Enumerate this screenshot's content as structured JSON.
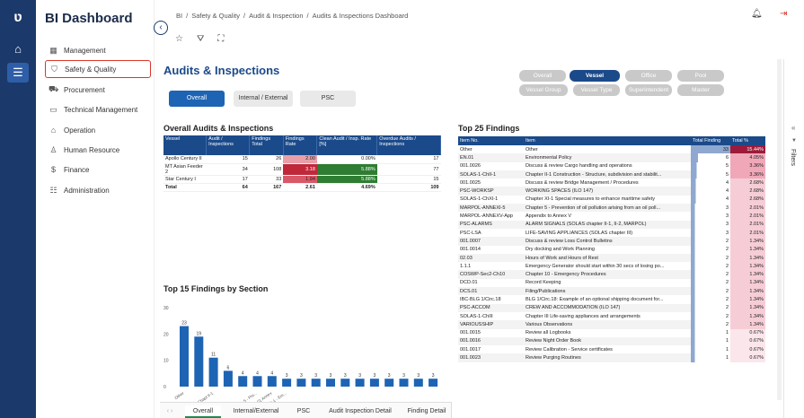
{
  "app": {
    "title": "BI Dashboard"
  },
  "rail": {
    "logo": "ʋ",
    "icons": [
      "home-icon",
      "list-icon"
    ]
  },
  "sidebar": {
    "items": [
      {
        "label": "Management",
        "icon": "grid-icon",
        "glyph": "▦"
      },
      {
        "label": "Safety & Quality",
        "icon": "shield-icon",
        "glyph": "⛉",
        "active": true
      },
      {
        "label": "Procurement",
        "icon": "cart-icon",
        "glyph": "⛟"
      },
      {
        "label": "Technical Management",
        "icon": "monitor-icon",
        "glyph": "▭"
      },
      {
        "label": "Operation",
        "icon": "building-icon",
        "glyph": "⌂"
      },
      {
        "label": "Human Resource",
        "icon": "person-icon",
        "glyph": "♙"
      },
      {
        "label": "Finance",
        "icon": "coin-icon",
        "glyph": "$"
      },
      {
        "label": "Administration",
        "icon": "people-icon",
        "glyph": "☷"
      }
    ]
  },
  "breadcrumb": [
    "BI",
    "/",
    "Safety & Quality",
    "/",
    "Audit & Inspection",
    "/",
    "Audits & Inspections Dashboard"
  ],
  "page_title": "Audits & Inspections",
  "filter_pills": {
    "row1": [
      "Overall",
      "Vessel",
      "Office",
      "Pool"
    ],
    "row2": [
      "Vessel Group",
      "Vessel Type",
      "Superintendent",
      "Master"
    ],
    "selected": "Vessel"
  },
  "view_tabs": [
    "Overall",
    "Internal / External",
    "PSC"
  ],
  "filters_label": "Filters",
  "overall": {
    "title": "Overall Audits & Inspections",
    "columns": [
      "Vessel",
      "Audit / Inspections",
      "Findings Total",
      "Findings Rate",
      "Clean Audit / Insp. Rate [%]",
      "Overdue Audits / Inspections"
    ],
    "rows": [
      [
        "Apollo Century II",
        "15",
        "26",
        "2.00",
        "0.00%",
        "17"
      ],
      [
        "MT Asian Feeder 2",
        "34",
        "108",
        "3.18",
        "5.88%",
        "77"
      ],
      [
        "Star Century I",
        "17",
        "33",
        "1.94",
        "5.88%",
        "15"
      ]
    ],
    "total": [
      "Total",
      "64",
      "167",
      "2.61",
      "4.69%",
      "109"
    ],
    "rate_colors": [
      "#e8a0a8",
      "#c0283a",
      "#d85868"
    ],
    "clean_colors": [
      "#ffffff",
      "#2e7d32",
      "#2e7d32"
    ]
  },
  "top25": {
    "title": "Top 25 Findings",
    "columns": [
      "Item No.",
      "Item",
      "Total Finding",
      "Total %"
    ],
    "rows": [
      [
        "Other",
        "Other",
        "33",
        "15.44%"
      ],
      [
        "EN.01",
        "Environmental Policy",
        "6",
        "4.05%"
      ],
      [
        "001.0026",
        "Discuss & review Cargo handling and operations",
        "5",
        "3.36%"
      ],
      [
        "SOLAS-1-ChII-1",
        "Chapter II-1 Construction - Structure, subdivision and stabilit...",
        "5",
        "3.36%"
      ],
      [
        "001.0025",
        "Discuss & review Bridge Management / Procedures",
        "4",
        "2.68%"
      ],
      [
        "PSC-WORKSP",
        "WORKING SPACES (ILO 147)",
        "4",
        "2.68%"
      ],
      [
        "SOLAS-1-ChXI-1",
        "Chapter XI-1 Special measures to enhance maritime safety",
        "4",
        "2.68%"
      ],
      [
        "MARPOL-ANNEXI-5",
        "Chapter 5 - Prevention of oil pollution arising from an oil poll...",
        "3",
        "2.01%"
      ],
      [
        "MARPOL-ANNEXV-App",
        "Appendix to Annex V",
        "3",
        "2.01%"
      ],
      [
        "PSC-ALARMS",
        "ALARM SIGNALS (SOLAS chapter II-1, II-2, MARPOL)",
        "3",
        "2.01%"
      ],
      [
        "PSC-LSA",
        "LIFE-SAVING APPLIANCES (SOLAS chapter III)",
        "3",
        "2.01%"
      ],
      [
        "001.0007",
        "Discuss & review Loss Control Bulletins",
        "2",
        "1.34%"
      ],
      [
        "001.0014",
        "Dry docking and Work Planning",
        "2",
        "1.34%"
      ],
      [
        "02.03",
        "Hours of Work and Hours of Rest",
        "2",
        "1.34%"
      ],
      [
        "1.1.1",
        "Emergency Generator should start within 30 secs of losing po...",
        "2",
        "1.34%"
      ],
      [
        "COSWP-Sec2-Ch10",
        "Chapter 10 - Emergency Procedures",
        "2",
        "1.34%"
      ],
      [
        "DCD.01",
        "Record Keeping",
        "2",
        "1.34%"
      ],
      [
        "DCS.01",
        "Filing/Publications",
        "2",
        "1.34%"
      ],
      [
        "IBC-BLG 1/Circ.18",
        "BLG 1/Circ.18: Example of an optional shipping document for...",
        "2",
        "1.34%"
      ],
      [
        "PSC-ACCOM",
        "CREW AND ACCOMMODATION (ILO 147)",
        "2",
        "1.34%"
      ],
      [
        "SOLAS-1-ChIII",
        "Chapter III Life-saving appliances and arrangements",
        "2",
        "1.34%"
      ],
      [
        "VARIOUSSHIP",
        "Various Observations",
        "2",
        "1.34%"
      ],
      [
        "001.0015",
        "Review all Logbooks",
        "1",
        "0.67%"
      ],
      [
        "001.0016",
        "Review Night Order Book",
        "1",
        "0.67%"
      ],
      [
        "001.0017",
        "Review Calibration - Service certificates",
        "1",
        "0.67%"
      ],
      [
        "001.0023",
        "Review Purging Routines",
        "1",
        "0.67%"
      ]
    ]
  },
  "chart_data": {
    "type": "bar",
    "title": "Top 15 Findings by Section",
    "categories": [
      "Other",
      "",
      "Chapt II-1",
      "",
      "",
      "Ch 5 - Pre...",
      "V/1 Annex",
      "S-1 - Em...",
      "",
      "",
      "",
      "",
      "",
      "",
      "",
      "",
      "",
      ""
    ],
    "values": [
      23,
      19,
      11,
      6,
      4,
      4,
      4,
      3,
      3,
      3,
      3,
      3,
      3,
      3,
      3,
      3,
      3,
      3
    ],
    "ylim": [
      0,
      30
    ],
    "yticks": [
      0,
      10,
      20,
      30
    ],
    "bar_color": "#1e64b4"
  },
  "bottom_tabs": [
    "Overall",
    "Internal/External",
    "PSC",
    "Audit Inspection Detail",
    "Finding Detail"
  ]
}
